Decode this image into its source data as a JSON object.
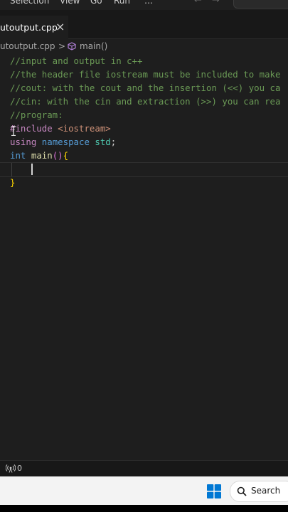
{
  "menubar": {
    "items": [
      "Selection",
      "View",
      "Go",
      "Run",
      "…"
    ],
    "back_icon": "arrow-left-icon",
    "forward_icon": "arrow-right-icon"
  },
  "tab": {
    "label": "utoutput.cpp",
    "close": "×"
  },
  "breadcrumb": {
    "file": "utoutput.cpp",
    "separator": ">",
    "symbol_icon": "cube-method-icon",
    "symbol": "main()"
  },
  "code": {
    "lines": [
      "//input and output in c++",
      "//the header file iostream must be included to make",
      "//cout: with the cout and the insertion (<<) you ca",
      "//cin: with the cin and extraction (>>) you can rea",
      "//program:",
      "#include <iostream>",
      "using namespace std;",
      "int main(){",
      "",
      "}"
    ],
    "tokens": {
      "hash": "#",
      "include": "include",
      "header": "<iostream>",
      "using": "using",
      "namespace": "namespace",
      "std": "std",
      "semi": ";",
      "int": "int",
      "main": "main",
      "parens": "()",
      "open_brace": "{",
      "close_brace": "}"
    }
  },
  "statusbar": {
    "ports_icon": "broadcast-icon",
    "count": "0"
  },
  "taskbar": {
    "start_icon": "windows-start-icon",
    "search_icon": "search-icon",
    "search_label": "Search"
  },
  "colors": {
    "editor_bg": "#1e1e1e",
    "comment": "#6a9955",
    "keyword": "#569cd6",
    "preprocessor": "#c586c0",
    "string": "#ce9178",
    "function": "#dcdcaa",
    "type": "#4ec9b0",
    "windows_blue": "#0078d4"
  }
}
